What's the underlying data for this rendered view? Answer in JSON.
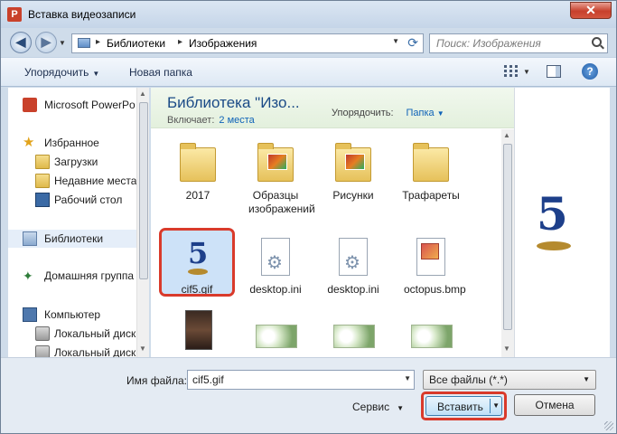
{
  "window": {
    "title": "Вставка видеозаписи",
    "close": "✕"
  },
  "address": {
    "crumbs": [
      "Библиотеки",
      "Изображения"
    ],
    "separator": "▸"
  },
  "search": {
    "placeholder": "Поиск: Изображения"
  },
  "toolbar": {
    "organize": "Упорядочить",
    "new_folder": "Новая папка",
    "help": "?"
  },
  "nav": {
    "items": [
      {
        "label": "Microsoft PowerPo",
        "icon": "powerpoint-icon"
      },
      {
        "label": "Избранное",
        "icon": "star-icon"
      },
      {
        "label": "Загрузки",
        "icon": "downloads-folder-icon"
      },
      {
        "label": "Недавние места",
        "icon": "recent-places-icon"
      },
      {
        "label": "Рабочий стол",
        "icon": "desktop-icon"
      },
      {
        "label": "Библиотеки",
        "icon": "libraries-icon"
      },
      {
        "label": "Домашняя группа",
        "icon": "homegroup-icon"
      },
      {
        "label": "Компьютер",
        "icon": "computer-icon"
      },
      {
        "label": "Локальный диск",
        "icon": "disk-icon"
      },
      {
        "label": "Локальный диск",
        "icon": "disk-icon"
      }
    ]
  },
  "library": {
    "title": "Библиотека \"Изо...",
    "includes_label": "Включает:",
    "includes_link": "2 места",
    "arrange_label": "Упорядочить:",
    "arrange_value": "Папка"
  },
  "files": [
    {
      "name": "2017",
      "kind": "folder"
    },
    {
      "name": "Образцы изображений",
      "kind": "folder-images"
    },
    {
      "name": "Рисунки",
      "kind": "folder-images"
    },
    {
      "name": "Трафареты",
      "kind": "folder"
    },
    {
      "name": "cif5.gif",
      "kind": "gif"
    },
    {
      "name": "desktop.ini",
      "kind": "ini"
    },
    {
      "name": "desktop.ini",
      "kind": "ini"
    },
    {
      "name": "octopus.bmp",
      "kind": "bmp"
    },
    {
      "name": "",
      "kind": "portrait"
    },
    {
      "name": "",
      "kind": "flowers"
    },
    {
      "name": "",
      "kind": "flowers"
    },
    {
      "name": "",
      "kind": "flowers"
    }
  ],
  "preview": {
    "glyph": "5"
  },
  "bottom": {
    "filename_label": "Имя файла:",
    "filename_value": "cif5.gif",
    "filetype_value": "Все файлы (*.*)",
    "service": "Сервис",
    "insert": "Вставить",
    "cancel": "Отмена"
  },
  "colors": {
    "highlight": "#d93a2b",
    "link": "#0f63b8",
    "title": "#1a4a86"
  }
}
